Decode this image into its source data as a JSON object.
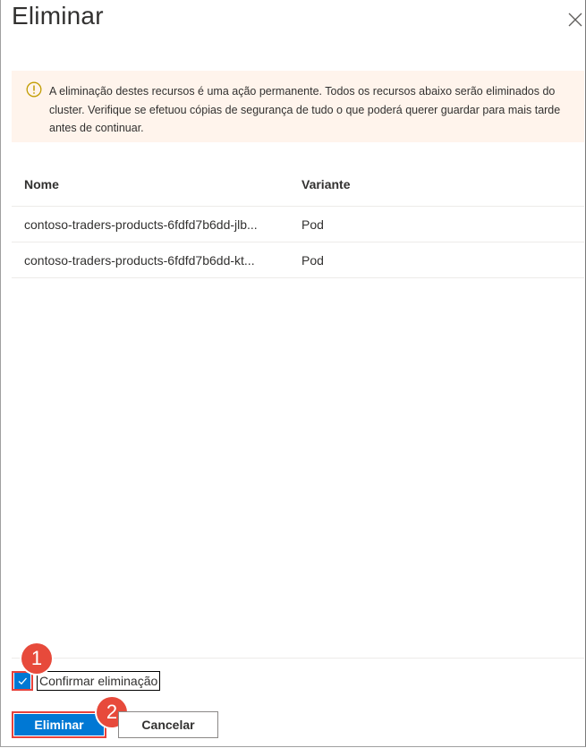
{
  "dialog": {
    "title": "Eliminar",
    "close_icon": "close-icon"
  },
  "warning": {
    "icon": "info-warning-icon",
    "text": "A eliminação destes recursos é uma ação permanente. Todos os recursos abaixo serão eliminados do cluster. Verifique se efetuou cópias de segurança de tudo o que poderá querer guardar para mais tarde antes de continuar.",
    "background": "#fff4ec",
    "icon_color": "#c19c00"
  },
  "table": {
    "headers": {
      "name": "Nome",
      "kind": "Variante"
    },
    "rows": [
      {
        "name": "contoso-traders-products-6fdfd7b6dd-jlb...",
        "kind": "Pod"
      },
      {
        "name": "contoso-traders-products-6fdfd7b6dd-kt...",
        "kind": "Pod"
      }
    ]
  },
  "confirm": {
    "checked": true,
    "label": "Confirmar eliminação"
  },
  "annotations": {
    "step1": "1",
    "step2": "2",
    "color": "#e74a3b"
  },
  "buttons": {
    "primary": "Eliminar",
    "secondary": "Cancelar",
    "accent": "#0078d4"
  }
}
